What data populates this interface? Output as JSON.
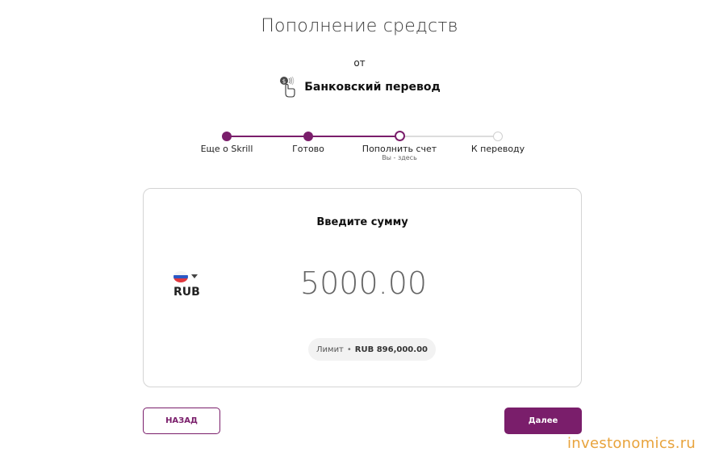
{
  "header": {
    "title": "Пополнение средств",
    "from_label": "от",
    "method_icon": "bank-transfer-hand-icon",
    "method_label": "Банковский перевод"
  },
  "stepper": {
    "steps": [
      {
        "label": "Еще о Skrill",
        "state": "done"
      },
      {
        "label": "Готово",
        "state": "done"
      },
      {
        "label": "Пополнить счет",
        "state": "current",
        "sub": "Вы - здесь"
      },
      {
        "label": "К переводу",
        "state": "todo"
      }
    ]
  },
  "card": {
    "title": "Введите сумму",
    "currency": {
      "code": "RUB",
      "flag_icon": "russia-flag-icon",
      "dropdown_icon": "caret-down-icon"
    },
    "amount": "5000.00",
    "limit": {
      "label": "Лимит",
      "separator": "•",
      "value": "RUB 896,000.00"
    }
  },
  "buttons": {
    "back_label": "НАЗАД",
    "next_label": "Далее"
  },
  "watermark": "investonomics.ru",
  "colors": {
    "brand": "#7a1e6b",
    "track_inactive": "#dcdcdc",
    "watermark": "#e8a33c"
  }
}
